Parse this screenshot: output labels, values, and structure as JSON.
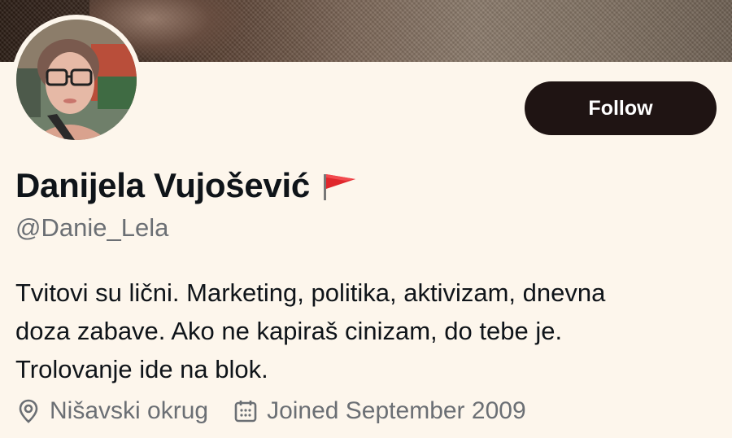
{
  "profile": {
    "display_name": "Danijela Vujošević",
    "name_emoji_icon": "red-flag-icon",
    "handle": "@Danie_Lela",
    "bio_lines": [
      "Tvitovi su lični. Marketing, politika, aktivizam, dnevna",
      "doza zabave. Ako ne kapiraš cinizam, do tebe je.",
      "Trolovanje ide na blok."
    ],
    "location": "Nišavski okrug",
    "location_icon": "location-pin-icon",
    "joined": "Joined September 2009",
    "joined_icon": "calendar-icon"
  },
  "actions": {
    "follow_label": "Follow"
  },
  "colors": {
    "background": "#fdf6ec",
    "follow_button": "#1f1413",
    "text_primary": "#0f1419",
    "text_secondary": "#6b6f74",
    "flag": "#e0272c"
  }
}
